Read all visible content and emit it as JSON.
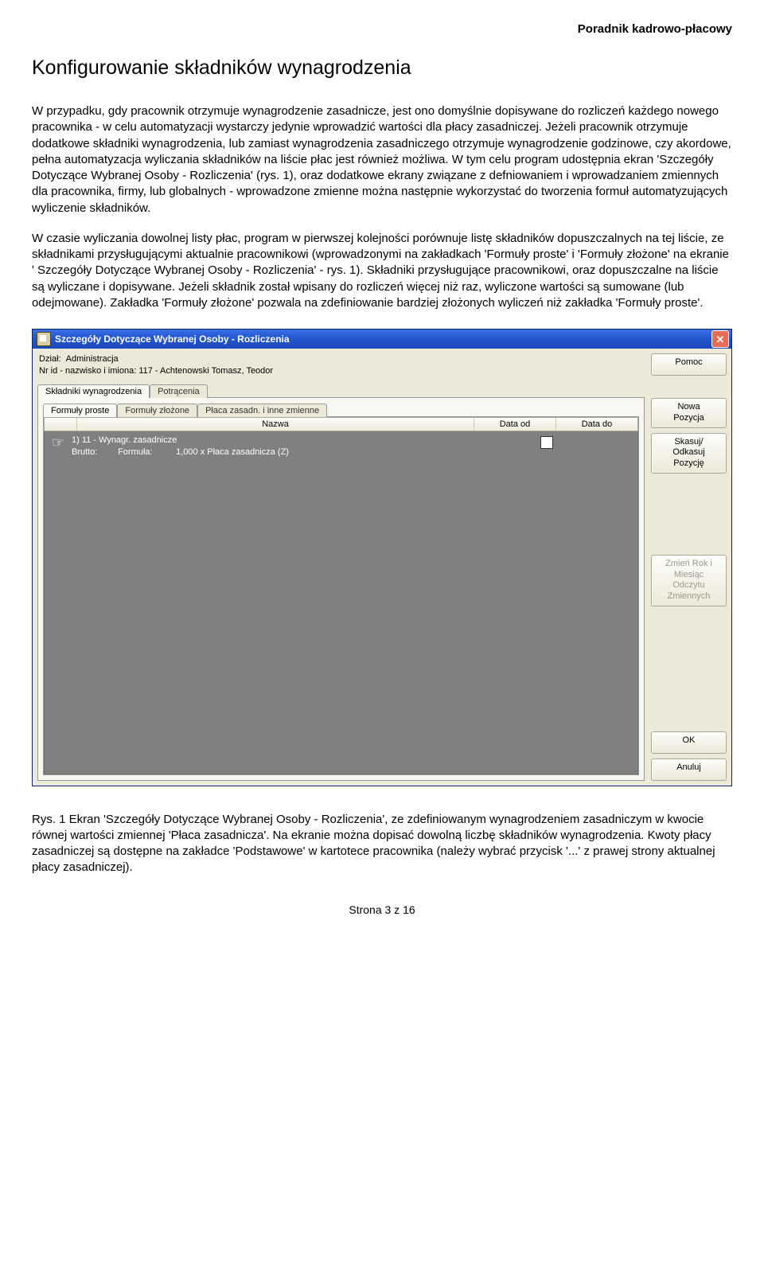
{
  "header_right": "Poradnik kadrowo-płacowy",
  "title": "Konfigurowanie składników wynagrodzenia",
  "paragraph1": "W przypadku, gdy pracownik otrzymuje wynagrodzenie zasadnicze, jest ono domyślnie dopisywane do rozliczeń każdego nowego pracownika - w celu automatyzacji wystarczy jedynie wprowadzić wartości dla płacy zasadniczej. Jeżeli pracownik otrzymuje dodatkowe składniki wynagrodzenia, lub zamiast wynagrodzenia zasadniczego otrzymuje wynagrodzenie godzinowe, czy akordowe, pełna automatyzacja wyliczania składników na liście płac jest również możliwa. W tym celu program udostępnia ekran 'Szczegóły Dotyczące Wybranej Osoby - Rozliczenia' (rys. 1), oraz dodatkowe ekrany związane z defniowaniem i wprowadzaniem zmiennych dla pracownika, firmy, lub globalnych - wprowadzone zmienne można następnie wykorzystać do tworzenia formuł automatyzujących wyliczenie składników.",
  "paragraph2": "W czasie wyliczania dowolnej listy płac, program w pierwszej kolejności porównuje listę składników dopuszczalnych na tej liście, ze składnikami przysługującymi aktualnie pracownikowi (wprowadzonymi na zakładkach 'Formuły proste' i 'Formuły złożone' na ekranie ' Szczegóły Dotyczące Wybranej Osoby - Rozliczenia' - rys. 1). Składniki przysługujące pracownikowi, oraz dopuszczalne na liście są wyliczane i dopisywane. Jeżeli składnik został wpisany do rozliczeń więcej niż raz, wyliczone wartości są sumowane (lub odejmowane). Zakładka 'Formuły złożone' pozwala na zdefiniowanie bardziej złożonych wyliczeń niż zakładka 'Formuły proste'.",
  "caption": "Rys. 1 Ekran 'Szczegóły Dotyczące Wybranej Osoby - Rozliczenia', ze zdefiniowanym wynagrodzeniem zasadniczym w kwocie równej wartości zmiennej 'Płaca zasadnicza'. Na ekranie można dopisać dowolną liczbę składników wynagrodzenia. Kwoty płacy zasadniczej są dostępne na zakładce 'Podstawowe' w kartotece pracownika (należy wybrać przycisk '...' z prawej strony aktualnej płacy zasadniczej).",
  "footer": "Strona 3 z 16",
  "window": {
    "title": "Szczegóły Dotyczące Wybranej Osoby - Rozliczenia",
    "info_line1_label": "Dział:",
    "info_line1_value": "Administracja",
    "info_line2": "Nr id - nazwisko i imiona: 117 - Achtenowski Tomasz, Teodor",
    "tabs1": {
      "active": "Składniki wynagrodzenia",
      "inactive": "Potrącenia"
    },
    "tabs2": {
      "active": "Formuły proste",
      "t2": "Formuły złożone",
      "t3": "Płaca zasadn. i inne zmienne"
    },
    "cols": {
      "name": "Nazwa",
      "from": "Data od",
      "to": "Data do"
    },
    "row": {
      "line1": "1)  11 - Wynagr. zasadnicze",
      "line2_a": "Brutto:",
      "line2_b": "Formuła:",
      "line2_c": "1,000 x Płaca zasadnicza (Z)"
    },
    "buttons": {
      "help": "Pomoc",
      "new": "Nowa\nPozycja",
      "del": "Skasuj/\nOdkasuj\nPozycję",
      "zmien": "Zmień Rok i\nMiesiąc\nOdczytu\nZmiennych",
      "ok": "OK",
      "cancel": "Anuluj"
    }
  }
}
